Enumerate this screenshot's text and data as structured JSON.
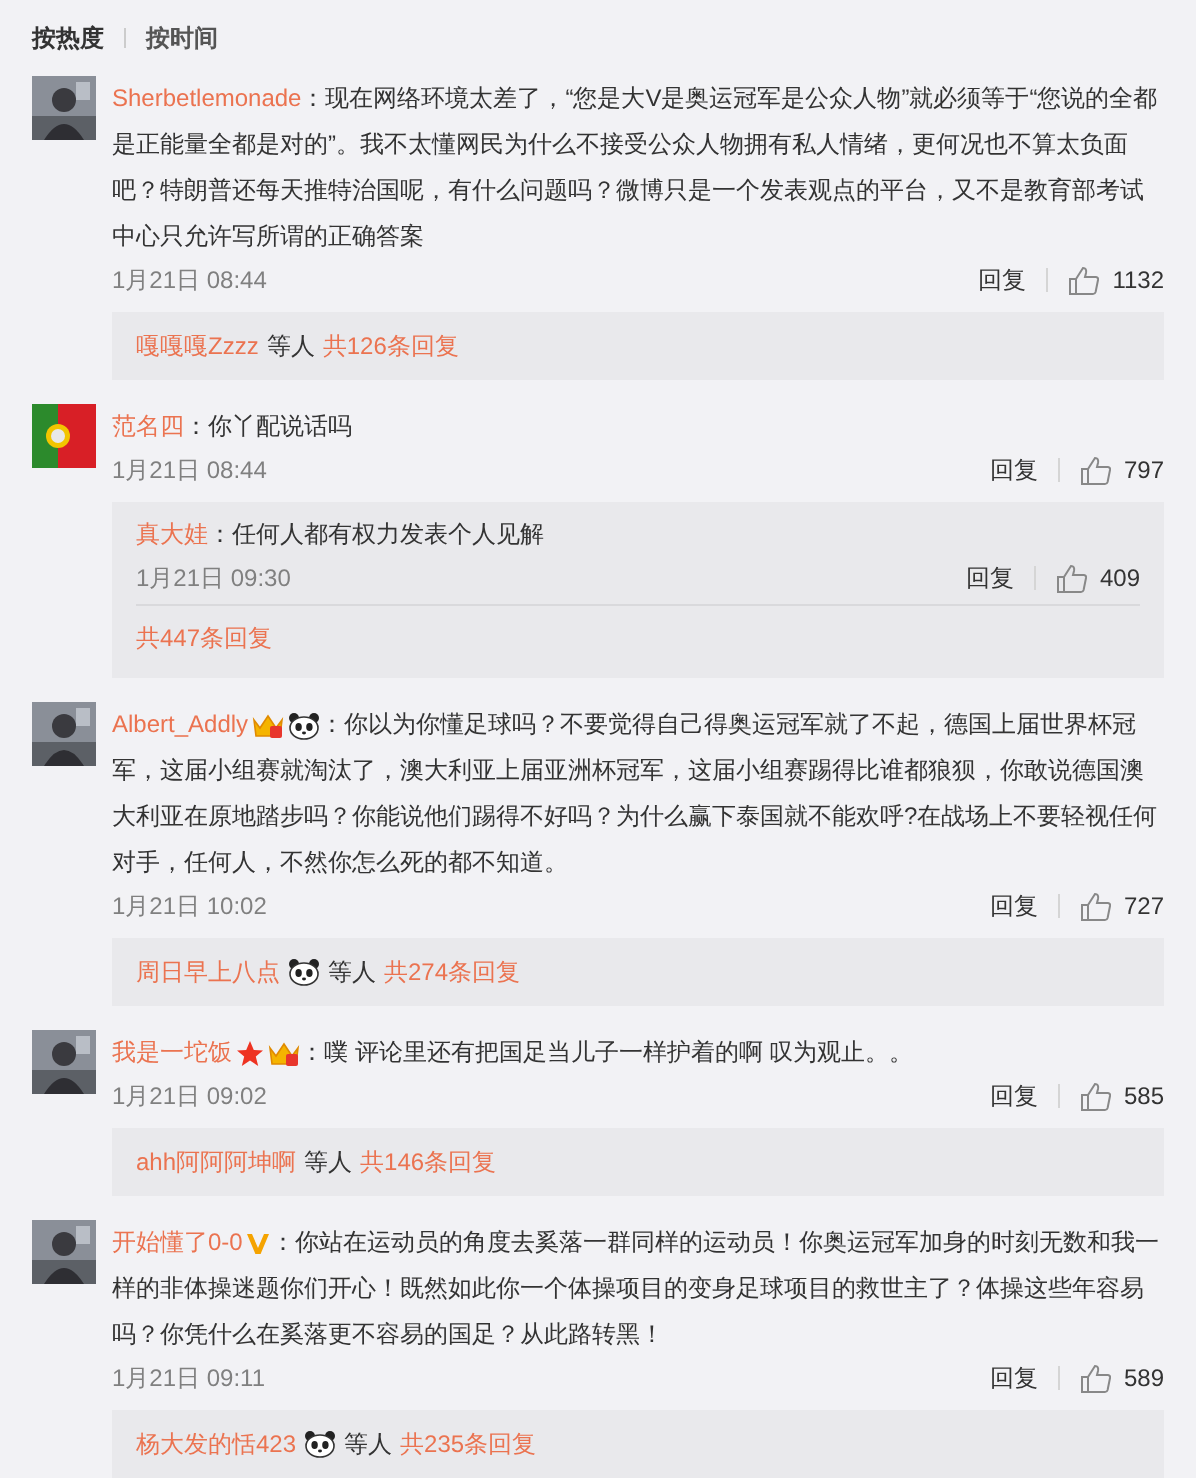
{
  "sort_tabs": [
    {
      "label": "按热度",
      "selected": true
    },
    {
      "label": "按时间",
      "selected": false
    }
  ],
  "comments": [
    {
      "avatar": {
        "kind": "picture"
      },
      "user": "Sherbetlemonade",
      "text": "：现在网络环境太差了，“您是大V是奥运冠军是公众人物”就必须等于“您说的全都是正能量全都是对的”。我不太懂网民为什么不接受公众人物拥有私人情绪，更何况也不算太负面吧？特朗普还每天推特治国呢，有什么问题吗？微博只是一个发表观点的平台，又不是教育部考试中心只允许写所谓的正确答案",
      "time": "1月21日 08:44",
      "reply": "回复",
      "likes": "1132",
      "replies": {
        "kind": "summary",
        "users": [
          {
            "name": "嘎嘎嘎Zzzz"
          }
        ],
        "suffix": "等人",
        "total": "共126条回复"
      }
    },
    {
      "avatar": {
        "kind": "flag"
      },
      "user": "范名四",
      "text": "：你丫配说话吗",
      "time": "1月21日 08:44",
      "reply": "回复",
      "likes": "797",
      "replies": {
        "kind": "thread",
        "items": [
          {
            "user": "真大娃",
            "text": "：任何人都有权力发表个人见解",
            "time": "1月21日 09:30",
            "reply": "回复",
            "likes": "409"
          }
        ],
        "total": "共447条回复"
      }
    },
    {
      "avatar": {
        "kind": "picture"
      },
      "user": "Albert_Addly",
      "badges": [
        {
          "kind": "crown"
        },
        {
          "kind": "panda"
        }
      ],
      "text": "：你以为你懂足球吗？不要觉得自己得奥运冠军就了不起，德国上届世界杯冠军，这届小组赛就淘汰了，澳大利亚上届亚洲杯冠军，这届小组赛踢得比谁都狼狈，你敢说德国澳大利亚在原地踏步吗？你能说他们踢得不好吗？为什么赢下泰国就不能欢呼?在战场上不要轻视任何对手，任何人，不然你怎么死的都不知道。",
      "time": "1月21日 10:02",
      "reply": "回复",
      "likes": "727",
      "replies": {
        "kind": "summary",
        "users": [
          {
            "name": "周日早上八点",
            "badges": [
              {
                "kind": "panda"
              }
            ]
          }
        ],
        "suffix": "等人",
        "total": "共274条回复"
      }
    },
    {
      "avatar": {
        "kind": "picture"
      },
      "user": "我是一坨饭",
      "badges": [
        {
          "kind": "star"
        },
        {
          "kind": "crown"
        }
      ],
      "text": "：噗  评论里还有把国足当儿子一样护着的啊 叹为观止。。",
      "time": "1月21日 09:02",
      "reply": "回复",
      "likes": "585",
      "replies": {
        "kind": "summary",
        "users": [
          {
            "name": "ahh阿阿阿坤啊"
          }
        ],
        "suffix": "等人",
        "total": "共146条回复"
      }
    },
    {
      "avatar": {
        "kind": "picture"
      },
      "user": "开始懂了0-0",
      "badges": [
        {
          "kind": "verified"
        }
      ],
      "text": "：你站在运动员的角度去奚落一群同样的运动员！你奥运冠军加身的时刻无数和我一样的非体操迷题你们开心！既然如此你一个体操项目的变身足球项目的救世主了？体操这些年容易吗？你凭什么在奚落更不容易的国足？从此路转黑！",
      "time": "1月21日 09:11",
      "reply": "回复",
      "likes": "589",
      "replies": {
        "kind": "summary",
        "users": [
          {
            "name": "杨大发的恬423",
            "badges": [
              {
                "kind": "panda"
              }
            ]
          }
        ],
        "suffix": "等人",
        "total": "共235条回复"
      }
    }
  ]
}
